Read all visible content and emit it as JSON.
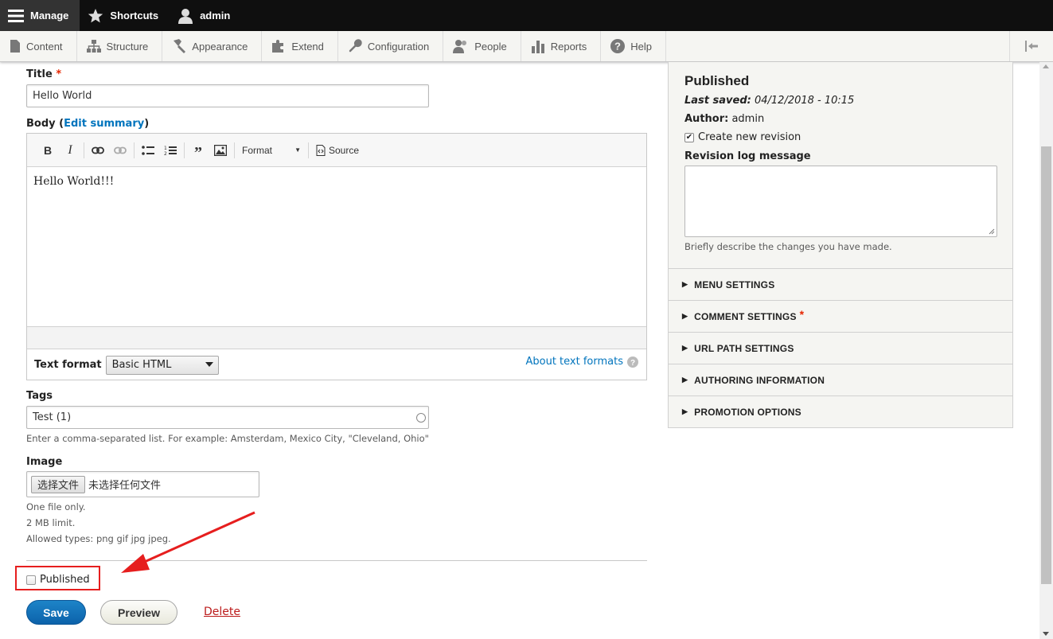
{
  "toolbar": {
    "manage": "Manage",
    "shortcuts": "Shortcuts",
    "user": "admin"
  },
  "tray": {
    "items": [
      "Content",
      "Structure",
      "Appearance",
      "Extend",
      "Configuration",
      "People",
      "Reports",
      "Help"
    ]
  },
  "form": {
    "title_label": "Title",
    "title_required": "*",
    "title_value": "Hello World",
    "body_label_prefix": "Body (",
    "body_edit_summary": "Edit summary",
    "body_label_suffix": ")",
    "editor_format_label": "Format",
    "editor_source_label": "Source",
    "body_text": "Hello World!!!",
    "text_format_label": "Text format",
    "text_format_value": "Basic HTML",
    "about_text_formats": "About text formats",
    "tags_label": "Tags",
    "tags_value": "Test (1)",
    "tags_desc": "Enter a comma-separated list. For example: Amsterdam, Mexico City, \"Cleveland, Ohio\"",
    "image_label": "Image",
    "file_button": "选择文件",
    "file_status": "未选择任何文件",
    "image_desc_1": "One file only.",
    "image_desc_2": "2 MB limit.",
    "image_desc_3": "Allowed types: png gif jpg jpeg.",
    "published_label": "Published",
    "published_checked": false,
    "save": "Save",
    "preview": "Preview",
    "delete": "Delete"
  },
  "sidebar": {
    "status": "Published",
    "last_saved_label": "Last saved:",
    "last_saved_value": "04/12/2018 - 10:15",
    "author_label": "Author:",
    "author_value": "admin",
    "create_revision_label": "Create new revision",
    "create_revision_checked": true,
    "revision_log_label": "Revision log message",
    "revision_log_desc": "Briefly describe the changes you have made.",
    "details": [
      {
        "label": "MENU SETTINGS",
        "required": ""
      },
      {
        "label": "COMMENT SETTINGS",
        "required": "*"
      },
      {
        "label": "URL PATH SETTINGS",
        "required": ""
      },
      {
        "label": "AUTHORING INFORMATION",
        "required": ""
      },
      {
        "label": "PROMOTION OPTIONS",
        "required": ""
      }
    ]
  },
  "colors": {
    "accent": "#0074bd",
    "required": "#e62600",
    "annotation": "#e61e1e"
  }
}
